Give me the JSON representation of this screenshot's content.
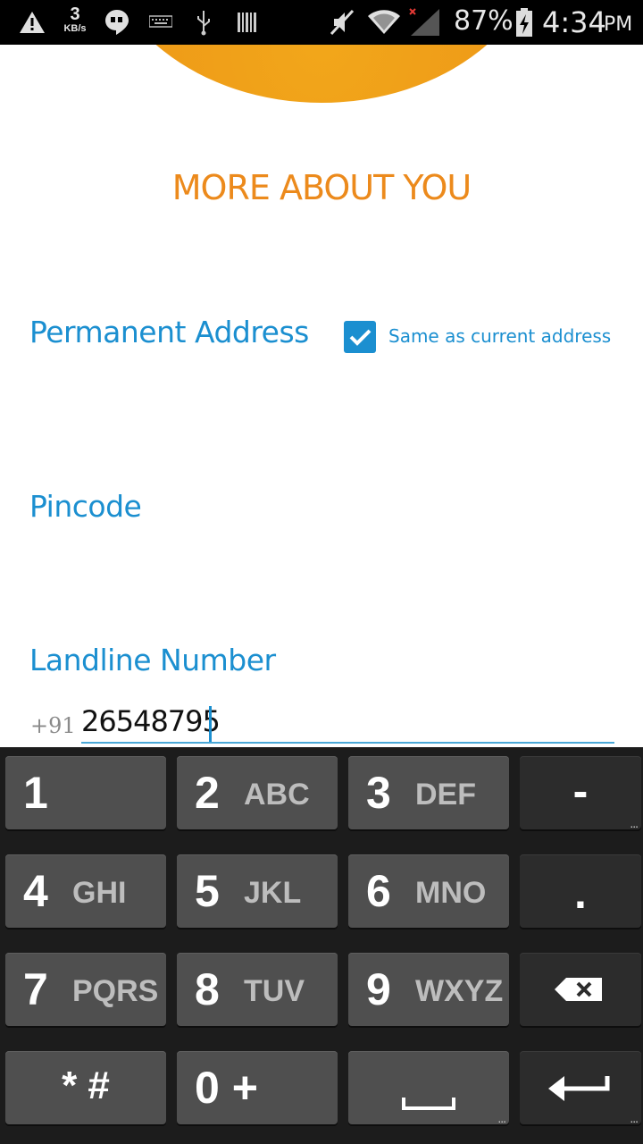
{
  "status_bar": {
    "speed_value": "3",
    "speed_unit": "KB/s",
    "battery_percent": "87%",
    "time": "4:34",
    "am_pm": "PM",
    "icons": [
      "warning-icon",
      "hangouts-icon",
      "keyboard-icon",
      "usb-icon",
      "barcode-icon",
      "mute-icon",
      "wifi-icon",
      "signal-icon",
      "battery-charging-icon"
    ]
  },
  "form": {
    "title": "MORE ABOUT YOU",
    "permanent_address_label": "Permanent Address",
    "same_address_checkbox": {
      "label": "Same as current address",
      "checked": true
    },
    "pincode_label": "Pincode",
    "landline_label": "Landline Number",
    "landline_prefix": "+91",
    "landline_value": "26548795"
  },
  "keyboard": {
    "rows": [
      [
        {
          "digit": "1",
          "letters": ""
        },
        {
          "digit": "2",
          "letters": "ABC"
        },
        {
          "digit": "3",
          "letters": "DEF"
        },
        {
          "symbol": "-"
        }
      ],
      [
        {
          "digit": "4",
          "letters": "GHI"
        },
        {
          "digit": "5",
          "letters": "JKL"
        },
        {
          "digit": "6",
          "letters": "MNO"
        },
        {
          "symbol": "."
        }
      ],
      [
        {
          "digit": "7",
          "letters": "PQRS"
        },
        {
          "digit": "8",
          "letters": "TUV"
        },
        {
          "digit": "9",
          "letters": "WXYZ"
        },
        {
          "icon": "backspace-icon"
        }
      ],
      [
        {
          "symbol": "* #"
        },
        {
          "symbol": "0 +"
        },
        {
          "icon": "space-icon"
        },
        {
          "icon": "enter-icon"
        }
      ]
    ]
  },
  "colors": {
    "accent_blue": "#1b8fd0",
    "title_orange": "#ec8a1c",
    "sun_orange": "#f2a71a",
    "keyboard_bg": "#1c1c1c",
    "key_bg": "#4f4f4f"
  }
}
